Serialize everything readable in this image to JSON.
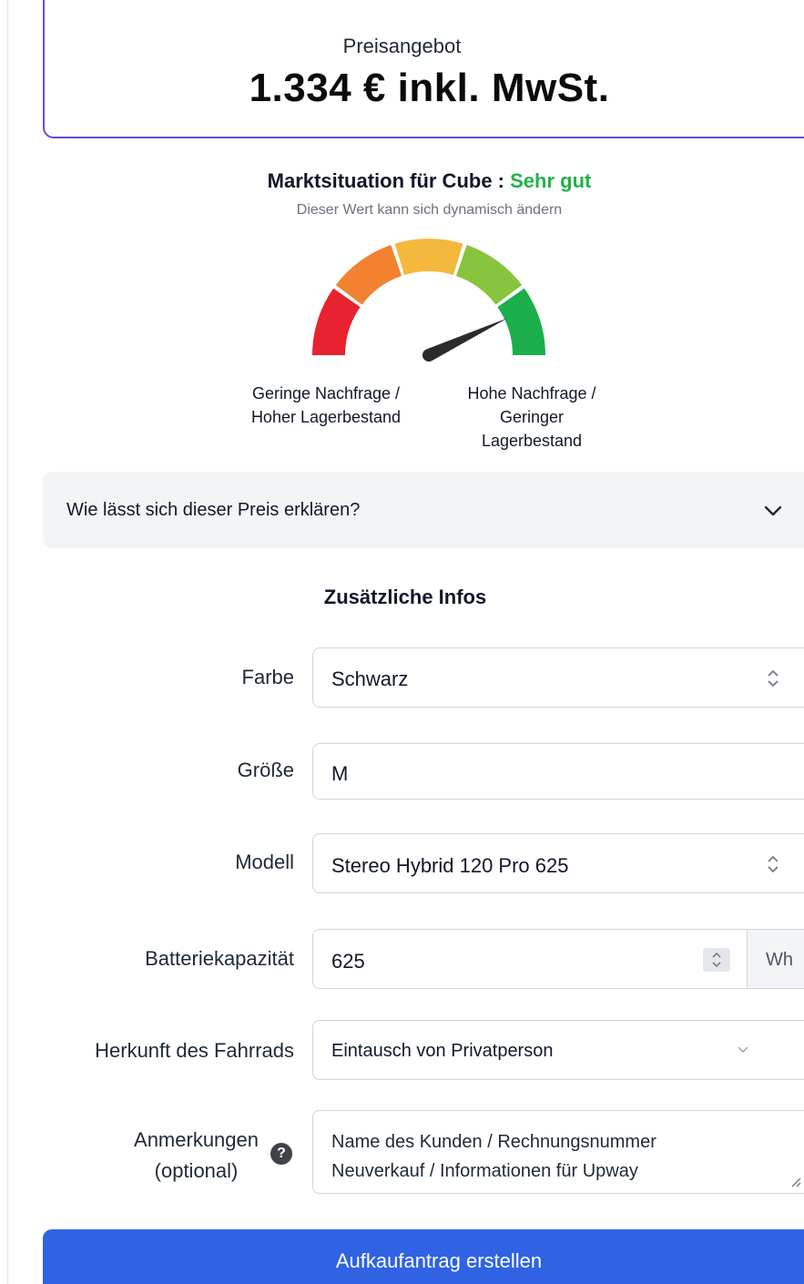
{
  "price": {
    "label": "Preisangebot",
    "value": "1.334 € inkl. MwSt."
  },
  "market": {
    "title_prefix": "Marktsituation für Cube : ",
    "status": "Sehr gut",
    "status_color": "#22b14c",
    "subtitle": "Dieser Wert kann sich dynamisch ändern",
    "gauge_level_fraction": 0.86,
    "segment_colors": [
      "#e8222e",
      "#f2822f",
      "#f4b83c",
      "#88c43e",
      "#1cae4a"
    ],
    "label_low": "Geringe Nachfrage / Hoher Lagerbestand",
    "label_high": "Hohe Nachfrage / Geringer Lagerbestand"
  },
  "accordion": {
    "label": "Wie lässt sich dieser Preis erklären?",
    "icon": "chevron-down-icon"
  },
  "section": {
    "title": "Zusätzliche Infos"
  },
  "form": {
    "color": {
      "label": "Farbe",
      "value": "Schwarz"
    },
    "size": {
      "label": "Größe",
      "value": "M"
    },
    "model": {
      "label": "Modell",
      "value": "Stereo Hybrid 120 Pro 625"
    },
    "battery": {
      "label": "Batteriekapazität",
      "value": "625",
      "unit": "Wh"
    },
    "origin": {
      "label": "Herkunft des Fahrrads",
      "value": "Eintausch von Privatperson"
    },
    "notes": {
      "label_line1": "Anmerkungen",
      "label_line2": "(optional)",
      "placeholder_line1": "Name des Kunden / Rechnungsnummer",
      "placeholder_line2": "Neuverkauf / Informationen für Upway",
      "help_icon": "question-circle-icon"
    }
  },
  "submit": {
    "label": "Aufkaufantrag erstellen",
    "color": "#2f63e4"
  }
}
